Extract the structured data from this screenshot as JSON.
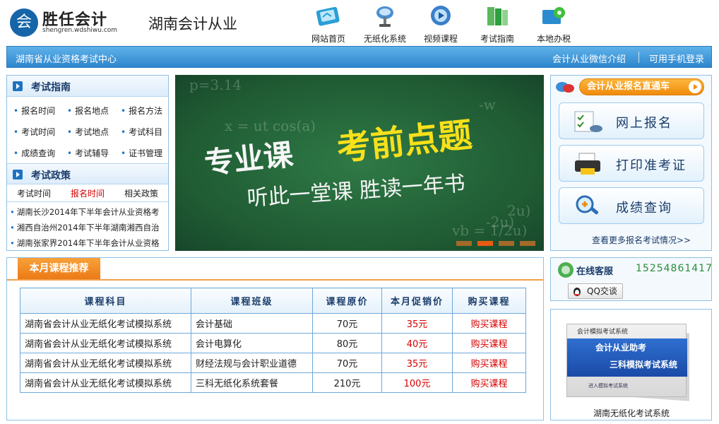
{
  "header": {
    "logo_char": "会",
    "logo_name": "胜任会计",
    "logo_domain": "shengren.wdshiwu.com",
    "site_title": "湖南会计从业",
    "nav": [
      {
        "label": "网站首页",
        "icon": "book-icon"
      },
      {
        "label": "无纸化系统",
        "icon": "satellite-dish-icon"
      },
      {
        "label": "视频课程",
        "icon": "video-globe-icon"
      },
      {
        "label": "考试指南",
        "icon": "books-icon"
      },
      {
        "label": "本地办税",
        "icon": "gear-folder-icon"
      }
    ]
  },
  "bluebar": {
    "left": "湖南省从业资格考试中心",
    "wechat": "会计从业微信介绍",
    "mobile": "可用手机登录"
  },
  "guide": {
    "title": "考试指南",
    "links": [
      "报名时间",
      "报名地点",
      "报名方法",
      "考试时间",
      "考试地点",
      "考试科目",
      "成绩查询",
      "考试辅导",
      "证书管理"
    ]
  },
  "policy": {
    "title": "考试政策",
    "tabs": [
      "考试时间",
      "报名时间",
      "相关政策"
    ],
    "news": [
      "湖南长沙2014年下半年会计从业资格考",
      "湘西自治州2014年下半年湖南湘西自治",
      "湖南张家界2014年下半年会计从业资格"
    ]
  },
  "banner": {
    "line1a": "专业课",
    "line1b": "考前点题",
    "line2": "听此一堂课  胜读一年书",
    "chalk": [
      "p=3.14",
      "x = ut cos(a)",
      "2u)",
      "-2u)",
      "vb = 1/2u)",
      "-w"
    ]
  },
  "signup": {
    "pill": "会计从业报名直通车",
    "buttons": [
      "网上报名",
      "打印准考证",
      "成绩查询"
    ],
    "more": "查看更多报名考试情况>>"
  },
  "courses": {
    "tab": "本月课程推荐",
    "headers": [
      "课程科目",
      "课程班级",
      "课程原价",
      "本月促销价",
      "购买课程"
    ],
    "rows": [
      [
        "湖南省会计从业无纸化考试模拟系统",
        "会计基础",
        "70元",
        "35元",
        "购买课程"
      ],
      [
        "湖南省会计从业无纸化考试模拟系统",
        "会计电算化",
        "80元",
        "40元",
        "购买课程"
      ],
      [
        "湖南省会计从业无纸化考试模拟系统",
        "财经法规与会计职业道德",
        "70元",
        "35元",
        "购买课程"
      ],
      [
        "湖南省会计从业无纸化考试模拟系统",
        "三科无纸化系统套餐",
        "210元",
        "100元",
        "购买课程"
      ]
    ]
  },
  "service": {
    "title": "在线客服",
    "phone": "15254861417",
    "qq": "QQ交谈"
  },
  "product": {
    "box_top": "会计模拟考试系统",
    "box_line1": "会计从业助考",
    "box_line2": "三科模拟考试系统",
    "box_small": "进入模拟考试系统",
    "caption": "湖南无纸化考试系统"
  },
  "colors": {
    "accent": "#2e86cc",
    "orange": "#ec7a16",
    "price_red": "#d40000"
  }
}
